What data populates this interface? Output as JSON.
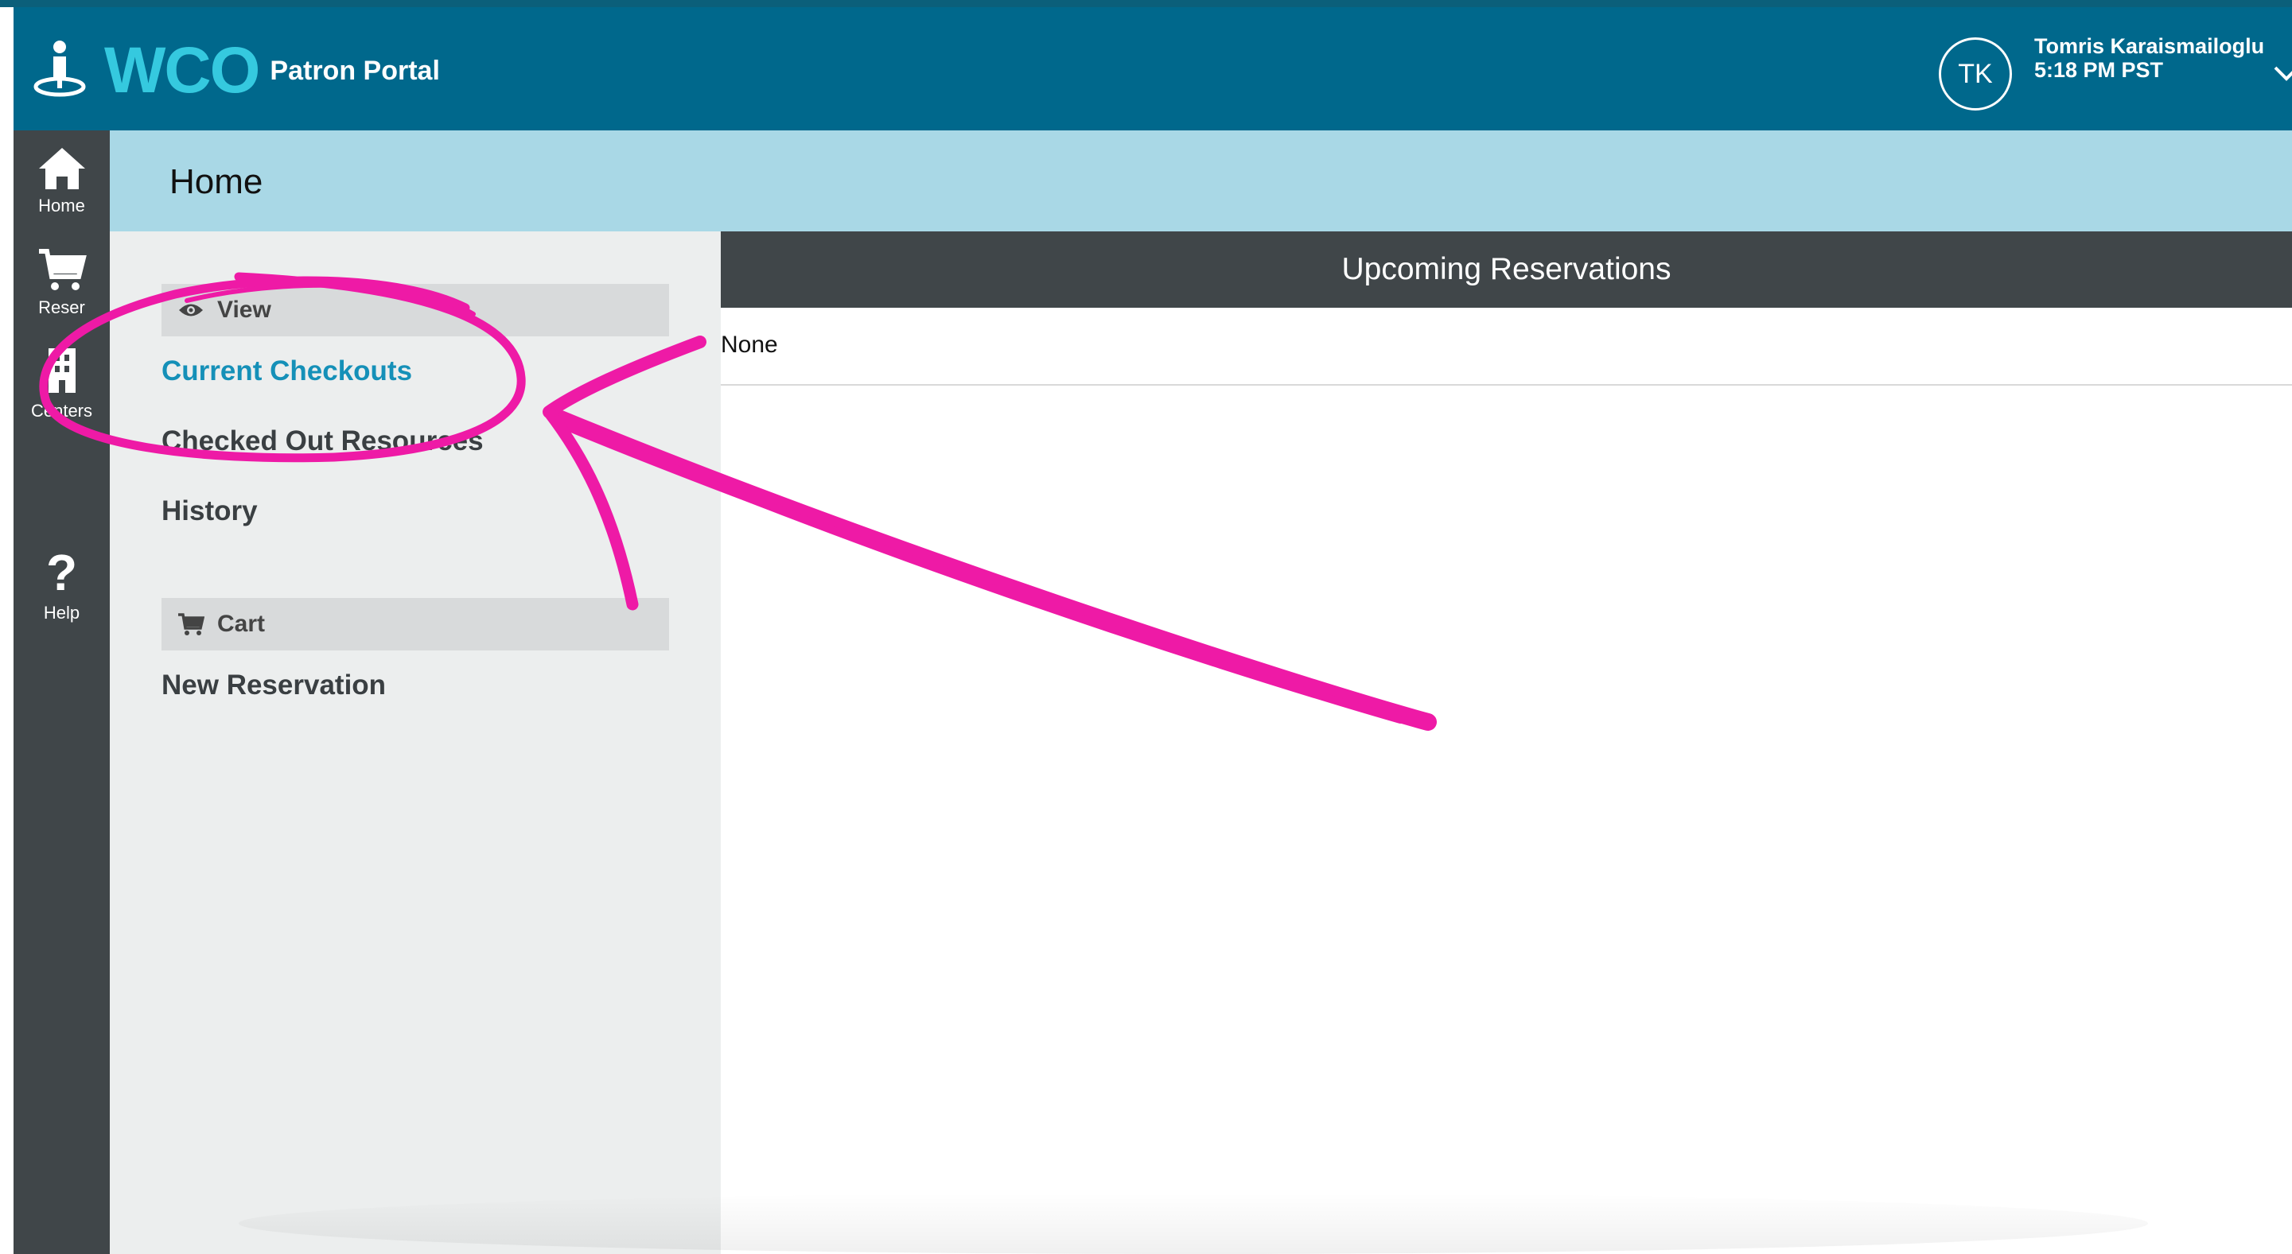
{
  "header": {
    "logo_text": "WCO",
    "portal_title": "Patron Portal",
    "avatar_initials": "TK",
    "user_name": "Tomris Karaismailoglu",
    "user_time": "5:18 PM PST"
  },
  "rail": {
    "items": [
      {
        "label": "Home",
        "icon": "home-icon"
      },
      {
        "label": "Reser",
        "icon": "cart-icon"
      },
      {
        "label": "Centers",
        "icon": "building-icon"
      },
      {
        "label": "Help",
        "icon": "question-icon",
        "glyph": "?"
      }
    ]
  },
  "page": {
    "title": "Home"
  },
  "menu": {
    "view_group": "View",
    "links": [
      "Current Checkouts",
      "Checked Out Resources",
      "History"
    ],
    "cart_group": "Cart",
    "cart_links": [
      "New Reservation"
    ]
  },
  "reservations": {
    "heading": "Upcoming Reservations",
    "empty_text": "None"
  },
  "colors": {
    "header_bg": "#00688c",
    "rail_bg": "#404649",
    "titlebar_bg": "#a9d8e6",
    "accent": "#1590b8",
    "logo": "#35c9df",
    "annotation": "#ee1aa6"
  }
}
